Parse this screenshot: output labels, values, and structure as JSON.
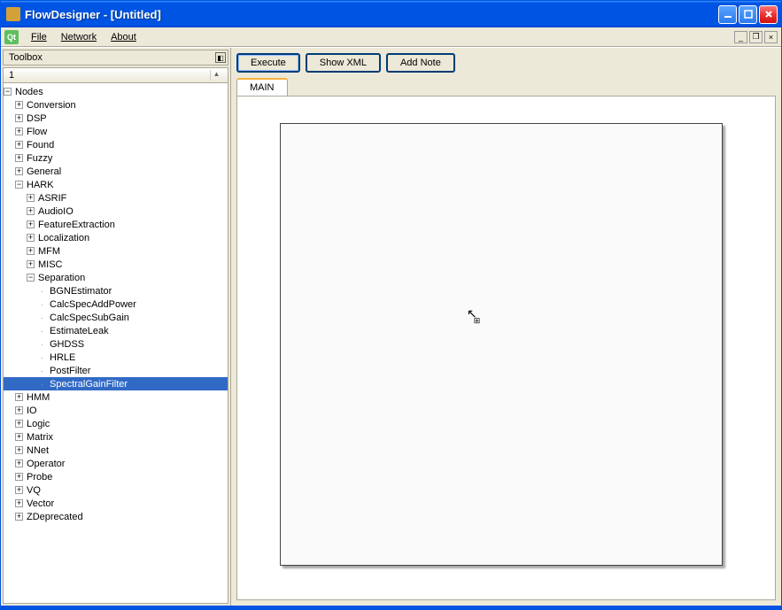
{
  "window": {
    "title": "FlowDesigner - [Untitled]"
  },
  "menu": {
    "file": "File",
    "network": "Network",
    "about": "About",
    "qt": "Qt"
  },
  "toolbox": {
    "title": "Toolbox",
    "column": "1"
  },
  "toolbar": {
    "execute": "Execute",
    "show_xml": "Show XML",
    "add_note": "Add Note"
  },
  "tabs": {
    "main": "MAIN"
  },
  "tree": {
    "root": "Nodes",
    "top": [
      "Conversion",
      "DSP",
      "Flow",
      "Found",
      "Fuzzy",
      "General"
    ],
    "hark": "HARK",
    "hark_children": [
      "ASRIF",
      "AudioIO",
      "FeatureExtraction",
      "Localization",
      "MFM",
      "MISC"
    ],
    "separation": "Separation",
    "separation_children": [
      "BGNEstimator",
      "CalcSpecAddPower",
      "CalcSpecSubGain",
      "EstimateLeak",
      "GHDSS",
      "HRLE",
      "PostFilter",
      "SpectralGainFilter"
    ],
    "selected": "SpectralGainFilter",
    "bottom": [
      "HMM",
      "IO",
      "Logic",
      "Matrix",
      "NNet",
      "Operator",
      "Probe",
      "VQ",
      "Vector",
      "ZDeprecated"
    ]
  }
}
